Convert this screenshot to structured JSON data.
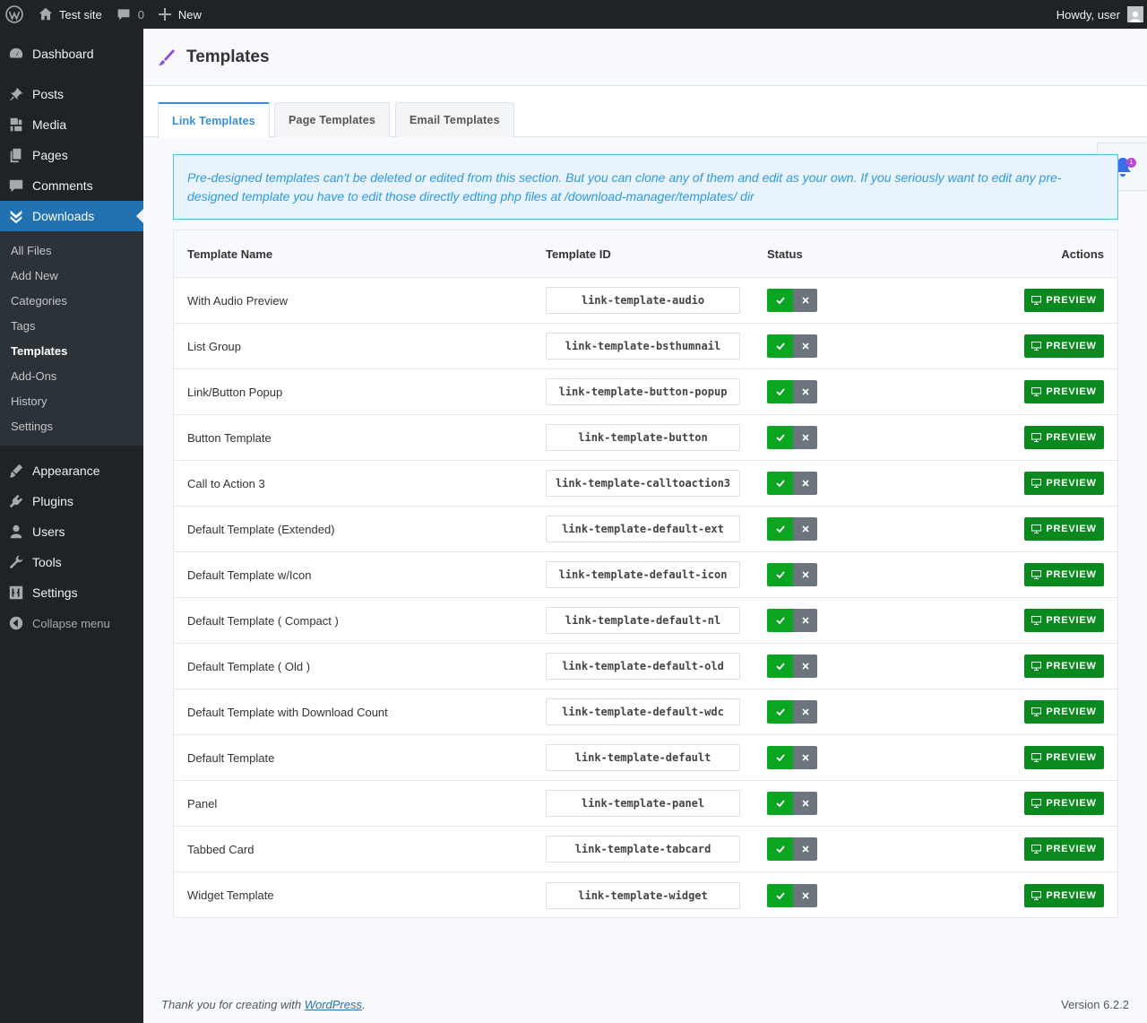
{
  "adminbar": {
    "wp_logo": "wordpress-logo",
    "site_name": "Test site",
    "comments_count": "0",
    "new_label": "New",
    "greeting": "Howdy, user"
  },
  "sidebar": {
    "items": [
      {
        "label": "Dashboard",
        "icon": "dashboard-icon"
      },
      {
        "label": "Posts",
        "icon": "pin-icon"
      },
      {
        "label": "Media",
        "icon": "media-icon"
      },
      {
        "label": "Pages",
        "icon": "pages-icon"
      },
      {
        "label": "Comments",
        "icon": "comment-icon"
      },
      {
        "label": "Downloads",
        "icon": "download-icon"
      }
    ],
    "submenu": [
      "All Files",
      "Add New",
      "Categories",
      "Tags",
      "Templates",
      "Add-Ons",
      "History",
      "Settings"
    ],
    "items_after": [
      {
        "label": "Appearance",
        "icon": "brush-icon"
      },
      {
        "label": "Plugins",
        "icon": "plugin-icon"
      },
      {
        "label": "Users",
        "icon": "user-icon"
      },
      {
        "label": "Tools",
        "icon": "wrench-icon"
      },
      {
        "label": "Settings",
        "icon": "settings-icon"
      }
    ],
    "collapse_label": "Collapse menu"
  },
  "header": {
    "title": "Templates"
  },
  "tabs": [
    "Link Templates",
    "Page Templates",
    "Email Templates"
  ],
  "bell_badge": "1",
  "notice": "Pre-designed templates can't be deleted or edited from this section. But you can clone any of them and edit as your own. If you seriously want to edit any pre-designed template you have to edit those directly edting php files at /download-manager/templates/ dir",
  "table": {
    "headers": [
      "Template Name",
      "Template ID",
      "Status",
      "Actions"
    ],
    "preview_label": "PREVIEW",
    "rows": [
      {
        "name": "With Audio Preview",
        "id": "link-template-audio"
      },
      {
        "name": "List Group",
        "id": "link-template-bsthumnail"
      },
      {
        "name": "Link/Button Popup",
        "id": "link-template-button-popup"
      },
      {
        "name": "Button Template",
        "id": "link-template-button"
      },
      {
        "name": "Call to Action 3",
        "id": "link-template-calltoaction3"
      },
      {
        "name": "Default Template (Extended)",
        "id": "link-template-default-ext"
      },
      {
        "name": "Default Template w/Icon",
        "id": "link-template-default-icon"
      },
      {
        "name": "Default Template ( Compact )",
        "id": "link-template-default-nl"
      },
      {
        "name": "Default Template ( Old )",
        "id": "link-template-default-old"
      },
      {
        "name": "Default Template with Download Count",
        "id": "link-template-default-wdc"
      },
      {
        "name": "Default Template",
        "id": "link-template-default"
      },
      {
        "name": "Panel",
        "id": "link-template-panel"
      },
      {
        "name": "Tabbed Card",
        "id": "link-template-tabcard"
      },
      {
        "name": "Widget Template",
        "id": "link-template-widget"
      }
    ]
  },
  "footer": {
    "thanks_prefix": "Thank you for creating with ",
    "thanks_link": "WordPress",
    "thanks_suffix": ".",
    "version": "Version 6.2.2"
  },
  "colors": {
    "accent": "#2271b1",
    "status_on": "#0ca521",
    "status_off": "#6c757d",
    "preview": "#0a8a1e",
    "tab_active": "#3a8ddb",
    "notice_text": "#2f9ae0",
    "badge": "#b44bd6"
  }
}
